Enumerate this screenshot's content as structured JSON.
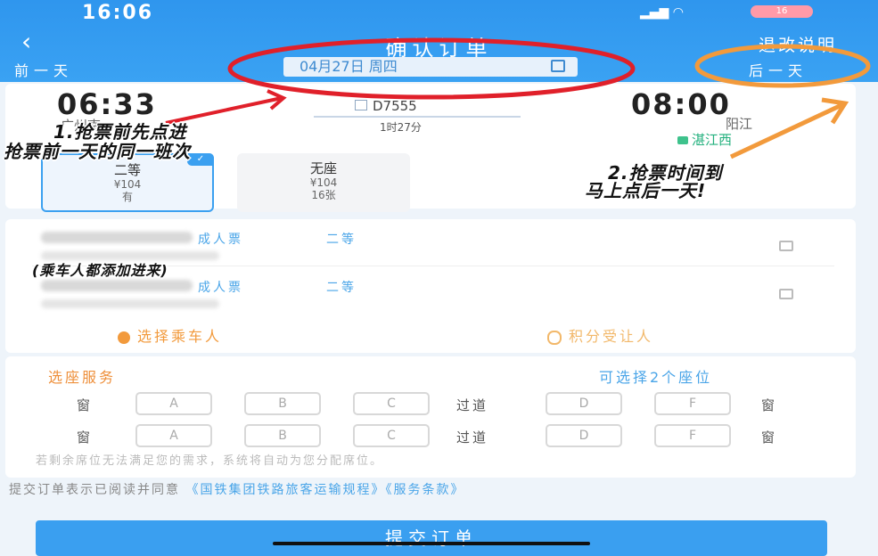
{
  "status_bar": {
    "time": "16:06",
    "battery": "16"
  },
  "nav": {
    "title": "确认订单",
    "right_action": "退改说明",
    "prev_day": "前一天",
    "next_day": "后一天",
    "date": "04月27日 周四"
  },
  "train": {
    "dep_time": "06:33",
    "dep_station": "广州南",
    "arr_time": "08:00",
    "arr_station": "阳江",
    "arr_station_2": "湛江西",
    "number": "D7555",
    "duration": "1时27分"
  },
  "seats": [
    {
      "name": "二等",
      "price": "¥104",
      "avail": "有",
      "selected": true
    },
    {
      "name": "无座",
      "price": "¥104",
      "avail": "16张",
      "selected": false
    }
  ],
  "passengers": [
    {
      "ticket_type": "成人票",
      "seat_class": "二等"
    },
    {
      "ticket_type": "成人票",
      "seat_class": "二等"
    }
  ],
  "actions": {
    "select_passenger": "选择乘车人",
    "points_transfer": "积分受让人"
  },
  "seat_service": {
    "title": "选座服务",
    "hint": "可选择2个座位",
    "window": "窗",
    "aisle": "过道",
    "letters": [
      "A",
      "B",
      "C",
      "D",
      "F"
    ],
    "note": "若剩余席位无法满足您的需求，系统将自动为您分配席位。"
  },
  "agreement": {
    "text": "提交订单表示已阅读并同意",
    "link1": "《国铁集团铁路旅客运输规程》",
    "link2": "《服务条款》"
  },
  "submit_label": "提交订单",
  "annotations": {
    "a1_line1": "1.抢票前先点进",
    "a1_line2": "抢票前一天的同一班次",
    "a2_line1": "2.抢票时间到",
    "a2_line2": "马上点后一天!",
    "a3": "(乘车人都添加进来)"
  },
  "colors": {
    "accent": "#3a9ff0",
    "annotation_red": "#e0202a",
    "annotation_orange": "#f29a3c"
  }
}
